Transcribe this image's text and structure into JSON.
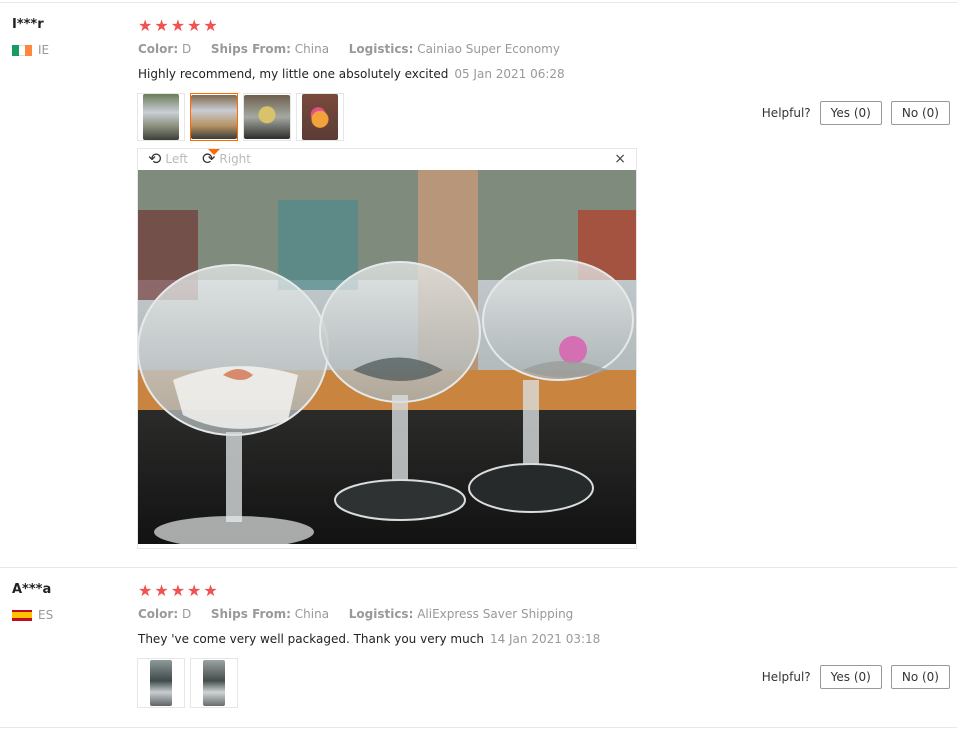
{
  "reviews": [
    {
      "user": "I***r",
      "country": "IE",
      "flag_colors": [
        "#169b62",
        "#ffffff",
        "#ff883e"
      ],
      "stars": 5,
      "color_label": "Color:",
      "color_value": "D",
      "ships_label": "Ships From:",
      "ships_value": "China",
      "logistics_label": "Logistics:",
      "logistics_value": "Cainiao Super Economy",
      "text": "Highly recommend, my little one absolutely excited",
      "date": "05 Jan 2021 06:28",
      "helpful_label": "Helpful?",
      "yes_label": "Yes (0)",
      "no_label": "No (0)",
      "viewer": {
        "left_label": "Left",
        "right_label": "Right",
        "close_icon": "×"
      }
    },
    {
      "user": "A***a",
      "country": "ES",
      "flag_colors": [
        "#c60b1e",
        "#ffc400",
        "#c60b1e"
      ],
      "stars": 5,
      "color_label": "Color:",
      "color_value": "D",
      "ships_label": "Ships From:",
      "ships_value": "China",
      "logistics_label": "Logistics:",
      "logistics_value": "AliExpress Saver Shipping",
      "text": "They 've come very well packaged. Thank you very much",
      "date": "14 Jan 2021 03:18",
      "helpful_label": "Helpful?",
      "yes_label": "Yes (0)",
      "no_label": "No (0)"
    }
  ],
  "colors": {
    "star": "#f05151",
    "accent": "#ff6a00"
  }
}
